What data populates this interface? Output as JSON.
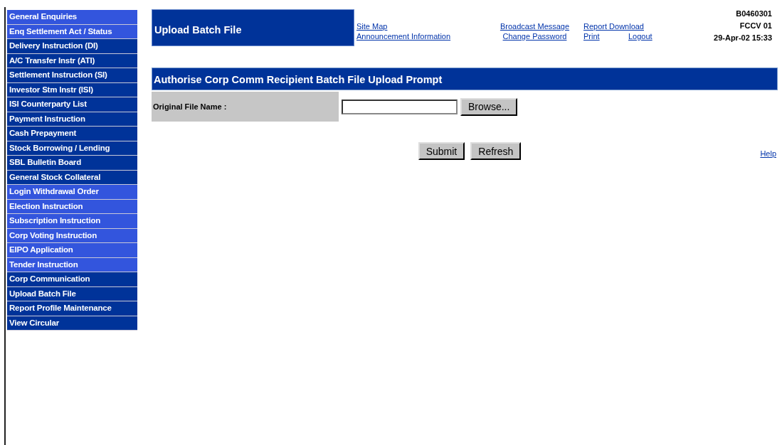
{
  "sidebar": {
    "items": [
      {
        "label": "General Enquiries",
        "color": "#3355dd"
      },
      {
        "label": "Enq Settlement Act / Status",
        "color": "#3355dd"
      },
      {
        "label": "Delivery Instruction (DI)",
        "color": "#003399"
      },
      {
        "label": "A/C Transfer Instr (ATI)",
        "color": "#003399"
      },
      {
        "label": "Settlement Instruction (SI)",
        "color": "#003399"
      },
      {
        "label": "Investor Stm Instr (ISI)",
        "color": "#003399"
      },
      {
        "label": "ISI Counterparty List",
        "color": "#003399"
      },
      {
        "label": "Payment Instruction",
        "color": "#003399"
      },
      {
        "label": "Cash Prepayment",
        "color": "#003399"
      },
      {
        "label": "Stock Borrowing / Lending",
        "color": "#003399"
      },
      {
        "label": "SBL Bulletin Board",
        "color": "#003399"
      },
      {
        "label": "General Stock Collateral",
        "color": "#003399"
      },
      {
        "label": "Login Withdrawal Order",
        "color": "#3355dd"
      },
      {
        "label": "Election Instruction",
        "color": "#3355dd"
      },
      {
        "label": "Subscription Instruction",
        "color": "#3355dd"
      },
      {
        "label": "Corp Voting Instruction",
        "color": "#3355dd"
      },
      {
        "label": "EIPO Application",
        "color": "#3355dd"
      },
      {
        "label": "Tender Instruction",
        "color": "#3355dd"
      },
      {
        "label": "Corp Communication",
        "color": "#003399"
      },
      {
        "label": "Upload Batch File",
        "color": "#003399"
      },
      {
        "label": "Report Profile Maintenance",
        "color": "#003399"
      },
      {
        "label": "View Circular",
        "color": "#003399"
      }
    ]
  },
  "header": {
    "title": "Upload Batch File",
    "link_rows": [
      [
        "Site Map",
        "Broadcast Message",
        "Report Download"
      ],
      [
        "Announcement Information",
        "Change Password",
        "Print",
        "Logout"
      ]
    ],
    "info": [
      "B0460301",
      "FCCV 01",
      "29-Apr-02 15:33"
    ]
  },
  "form": {
    "title": "Authorise Corp Comm Recipient Batch File Upload Prompt",
    "field_label": "Original File Name :",
    "browse_button": "Browse...",
    "buttons": [
      "Submit",
      "Refresh"
    ],
    "help_link": "Help"
  }
}
